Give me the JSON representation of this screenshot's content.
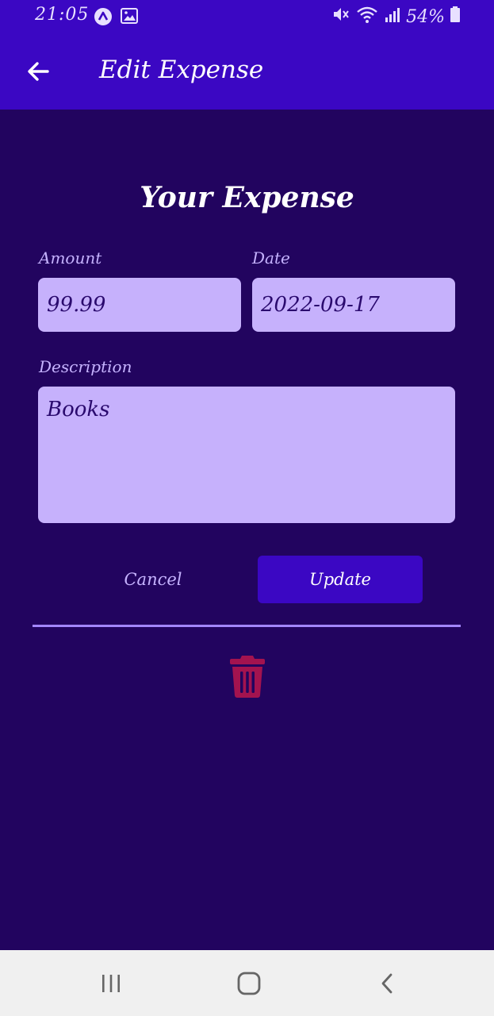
{
  "status_bar": {
    "time": "21:05",
    "battery": "54%",
    "icons": [
      "app-notification-icon",
      "image-icon",
      "mute-icon",
      "wifi-icon",
      "signal-icon",
      "battery-icon"
    ]
  },
  "app_bar": {
    "title": "Edit Expense",
    "back_icon": "arrow-left-icon"
  },
  "form": {
    "heading": "Your Expense",
    "amount": {
      "label": "Amount",
      "value": "99.99"
    },
    "date": {
      "label": "Date",
      "value": "2022-09-17"
    },
    "description": {
      "label": "Description",
      "value": "Books"
    }
  },
  "actions": {
    "cancel_label": "Cancel",
    "update_label": "Update",
    "delete_icon": "trash-icon"
  },
  "nav_bar": {
    "icons": [
      "recent-apps-icon",
      "home-icon",
      "back-icon"
    ]
  },
  "colors": {
    "background": "#22045f",
    "primary": "#3b07c3",
    "input_bg": "#c6b1fc",
    "label": "#c6b3ff",
    "divider": "#a386ff",
    "delete": "#a3134f",
    "nav_bg": "#f0f0f0"
  }
}
